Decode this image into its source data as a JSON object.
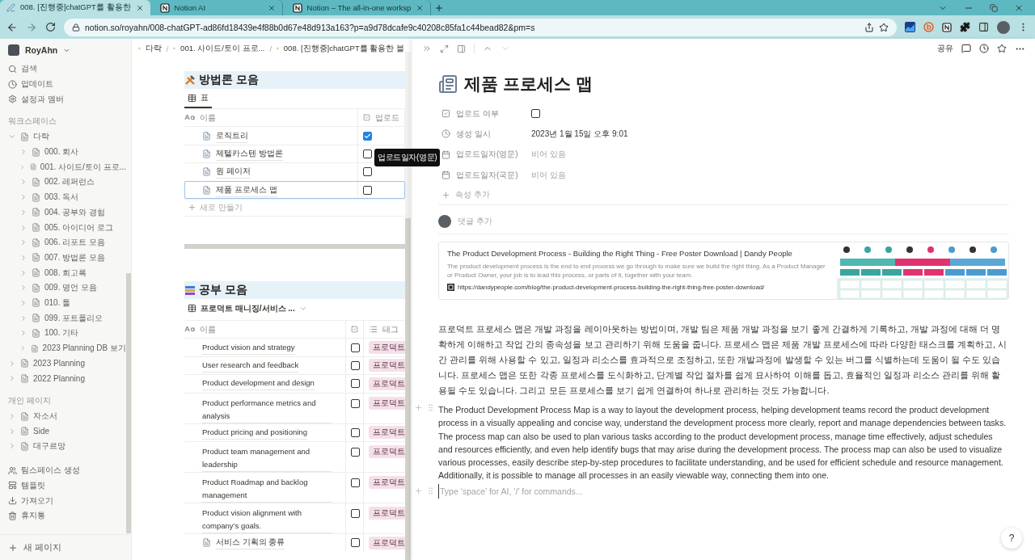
{
  "browser": {
    "tabs": [
      {
        "title": "008. [진행중]chatGPT를 활용한",
        "selected": true,
        "kind": "pen"
      },
      {
        "title": "Notion AI",
        "selected": false,
        "kind": "notion"
      },
      {
        "title": "Notion – The all-in-one worksp",
        "selected": false,
        "kind": "notion"
      }
    ],
    "url": "notion.so/royahn/008-chatGPT-ad86fd18439e4f88b0d67e48d913a163?p=a9d78dcafe9c40208c85fa1c44bead82&pm=s"
  },
  "sidebar": {
    "workspace": "RoyAhn",
    "actions": [
      {
        "kind": "search",
        "label": "검색"
      },
      {
        "kind": "updates",
        "label": "업데이트"
      },
      {
        "kind": "settings",
        "label": "설정과 멤버"
      }
    ],
    "sections": [
      {
        "label": "워크스페이스",
        "items": [
          {
            "label": "다락",
            "expanded": true,
            "children": [
              {
                "label": "000. 회사",
                "expanded": false
              },
              {
                "label": "001. 사이드/토이 프로...",
                "expanded": false
              },
              {
                "label": "002. 레퍼런스",
                "expanded": false
              },
              {
                "label": "003. 독서",
                "expanded": false
              },
              {
                "label": "004. 공부와 경험",
                "expanded": false
              },
              {
                "label": "005. 아이디어 로그",
                "expanded": false
              },
              {
                "label": "006. 리포트 모음",
                "expanded": false
              },
              {
                "label": "007. 방법론 모음",
                "expanded": false
              },
              {
                "label": "008. 회고록",
                "expanded": false
              },
              {
                "label": "009. 명언 모음",
                "expanded": false
              },
              {
                "label": "010. 툴",
                "expanded": false
              },
              {
                "label": "099. 포트폴리오",
                "expanded": false
              },
              {
                "label": "100. 기타",
                "expanded": false
              },
              {
                "label": "2023 Planning DB 보기",
                "expanded": false
              }
            ]
          },
          {
            "label": "2023 Planning",
            "expanded": false
          },
          {
            "label": "2022 Planning",
            "expanded": false
          }
        ]
      },
      {
        "label": "개인 페이지",
        "items": [
          {
            "label": "자소서",
            "expanded": false
          },
          {
            "label": "Side",
            "expanded": false
          },
          {
            "label": "대구르망",
            "expanded": false
          }
        ]
      }
    ],
    "tools": [
      {
        "kind": "teamspace",
        "label": "팀스페이스 생성"
      },
      {
        "kind": "templates",
        "label": "템플릿"
      },
      {
        "kind": "import",
        "label": "가져오기"
      },
      {
        "kind": "trash",
        "label": "휴지통"
      }
    ],
    "new_page": "새 페이지"
  },
  "main": {
    "separator": "/",
    "breadcrumbs": [
      "다락",
      "001. 사이드/토이 프로...",
      "008. [진행중]chatGPT를 활용한 블"
    ],
    "databases": [
      {
        "title": "방법론 모음",
        "views": [
          {
            "label": "표",
            "selected": true,
            "has_dropdown": false
          }
        ],
        "columns": [
          {
            "kind": "title",
            "label": "이름"
          },
          {
            "kind": "checkbox",
            "label": "업로드"
          }
        ],
        "rows": [
          {
            "name": "로직트리",
            "checked": true,
            "selected": false,
            "has_icon": true
          },
          {
            "name": "제텔카스텐 방법론",
            "checked": false,
            "selected": false,
            "has_icon": true
          },
          {
            "name": "원 페이저",
            "checked": false,
            "selected": false,
            "has_icon": true
          },
          {
            "name": "제품 프로세스 맵",
            "checked": false,
            "selected": true,
            "has_icon": true
          }
        ],
        "new_row": "새로 만들기"
      },
      {
        "title": "공부 모음",
        "views": [
          {
            "label": "프로덕트 매니징/서비스 ...",
            "selected": true,
            "has_dropdown": true
          }
        ],
        "columns": [
          {
            "kind": "title",
            "label": "이름"
          },
          {
            "kind": "checkbox"
          },
          {
            "kind": "tags",
            "label": "태그"
          }
        ],
        "rows": [
          {
            "name": "Product vision and strategy",
            "checked": false,
            "selected": false,
            "has_icon": false,
            "tag": "프로덕트"
          },
          {
            "name": "User research and feedback",
            "checked": false,
            "selected": false,
            "has_icon": false,
            "tag": "프로덕트"
          },
          {
            "name": "Product development and design",
            "checked": false,
            "selected": false,
            "has_icon": false,
            "tag": "프로덕트"
          },
          {
            "name": "Product performance metrics and analysis",
            "checked": false,
            "selected": false,
            "has_icon": false,
            "tag": "프로덕트"
          },
          {
            "name": "Product pricing and positioning",
            "checked": false,
            "selected": false,
            "has_icon": false,
            "tag": "프로덕트"
          },
          {
            "name": "Product team management and leadership",
            "checked": false,
            "selected": false,
            "has_icon": false,
            "tag": "프로덕트"
          },
          {
            "name": "Product Roadmap and backlog management",
            "checked": false,
            "selected": false,
            "has_icon": false,
            "tag": "프로덕트"
          },
          {
            "name": "Product vision alignment with company’s goals.",
            "checked": false,
            "selected": false,
            "has_icon": false,
            "tag": "프로덕트"
          },
          {
            "name": "서비스 기획의 종류",
            "checked": false,
            "selected": false,
            "has_icon": true,
            "tag": "프로덕트"
          }
        ]
      }
    ],
    "tooltip": "업로드일자(영문)"
  },
  "peek": {
    "share": "공유",
    "title": "제품 프로세스 맵",
    "properties": [
      {
        "kind": "checkbox",
        "name": "업로드 여부",
        "checked": false
      },
      {
        "kind": "created",
        "name": "생성 일시",
        "value": "2023년 1월 15일 오후 9:01",
        "empty": false
      },
      {
        "kind": "date",
        "name": "업로드일자(영문)",
        "value": "비어 있음",
        "empty": true
      },
      {
        "kind": "date",
        "name": "업로드일자(국문)",
        "value": "비어 있음",
        "empty": true
      }
    ],
    "add_property": "속성 추가",
    "comment_placeholder": "댓글 추가",
    "bookmark": {
      "title": "The Product Development Process - Building the Right Thing - Free Poster Download | Dandy People",
      "description": "The product development process is the end to end process we go through to make sure we build the right thing. As a Product Manager or Product Owner, your job is to lead this process, or parts of it, together with your team.",
      "url": "https://dandypeople.com/blog/the-product-development-process-building-the-right-thing-free-poster-download/"
    },
    "blocks": [
      {
        "kind": "paragraph",
        "handles": false,
        "text": "프로덕트 프로세스 맵은 개발 과정을 레이아웃하는 방법이며, 개발 팀은 제품 개발 과정을 보기 좋게 간결하게 기록하고, 개발 과정에 대해 더 명확하게 이해하고 작업 간의 종속성을 보고 관리하기 위해 도움을 줍니다. 프로세스 맵은 제품 개발 프로세스에 따라 다양한 태스크를 계획하고, 시간 관리를 위해 사용할 수 있고, 일정과 리소스를 효과적으로 조정하고, 또한 개발과정에 발생할 수 있는 버그를 식별하는데 도움이 될 수도 있습니다. 프로세스 맵은 또한 각종 프로세스를 도식화하고, 단계별 작업 절차를 쉽게 묘사하여 이해를 돕고, 효율적인 일정과 리소스 관리를 위해 활용될 수도 있습니다. 그리고 모든 프로세스를 보기 쉽게 연결하여 하나로 관리하는 것도 가능합니다."
      },
      {
        "kind": "paragraph",
        "handles": true,
        "text": "The Product Development Process Map is a way to layout the development process, helping development teams record the product development process in a visually appealing and concise way, understand the development process more clearly, report and manage dependencies between tasks. The process map can also be used to plan various tasks according to the product development process, manage time effectively, adjust schedules and resources efficiently, and even help identify bugs that may arise during the development process. The process map can also be used to visualize various processes, easily describe step-by-step procedures to facilitate understanding, and be used for efficient schedule and resource management. Additionally, it is possible to manage all processes in an easily viewable way, connecting them into one."
      },
      {
        "kind": "empty",
        "handles": true,
        "placeholder": "Type ‘space’ for AI, ‘/’ for commands..."
      }
    ],
    "help": "?"
  }
}
